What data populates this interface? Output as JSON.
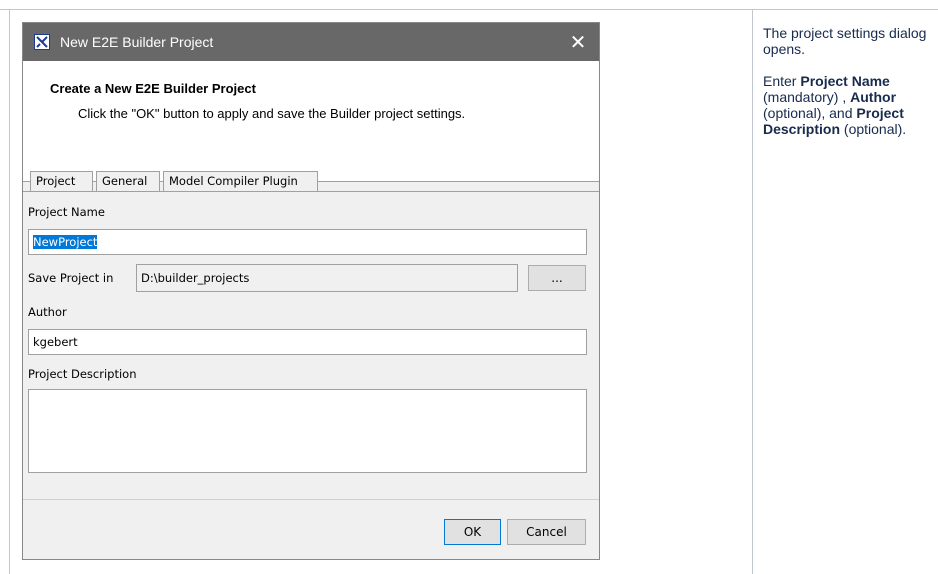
{
  "dialog": {
    "title": "New E2E Builder Project",
    "close_glyph": "✕",
    "header_title": "Create a New E2E Builder Project",
    "header_desc": "Click the \"OK\" button to apply and save the Builder project settings.",
    "tabs": [
      {
        "label": "Project",
        "active": true
      },
      {
        "label": "General",
        "active": false
      },
      {
        "label": "Model Compiler Plugin",
        "active": false
      }
    ],
    "project_name_label": "Project Name",
    "project_name_value": "NewProject",
    "save_in_label": "Save Project in",
    "save_in_value": "D:\\builder_projects",
    "browse_label": "...",
    "author_label": "Author",
    "author_value": "kgebert",
    "description_label": "Project Description",
    "description_value": "",
    "ok_label": "OK",
    "cancel_label": "Cancel",
    "icons": {
      "app": "e2e-builder-icon",
      "close": "close-icon"
    }
  },
  "note": {
    "line1": "The project settings dialog opens.",
    "enter": "Enter ",
    "project_name": "Project Name",
    "mandatory": " (mandatory) , ",
    "author": "Author",
    "optional_and": " (optional), and ",
    "project_description": "Project Description",
    "optional_end": " (optional)."
  },
  "colors": {
    "accent": "#0078d7",
    "titlebar": "#686868",
    "note_text": "#172b4d"
  }
}
